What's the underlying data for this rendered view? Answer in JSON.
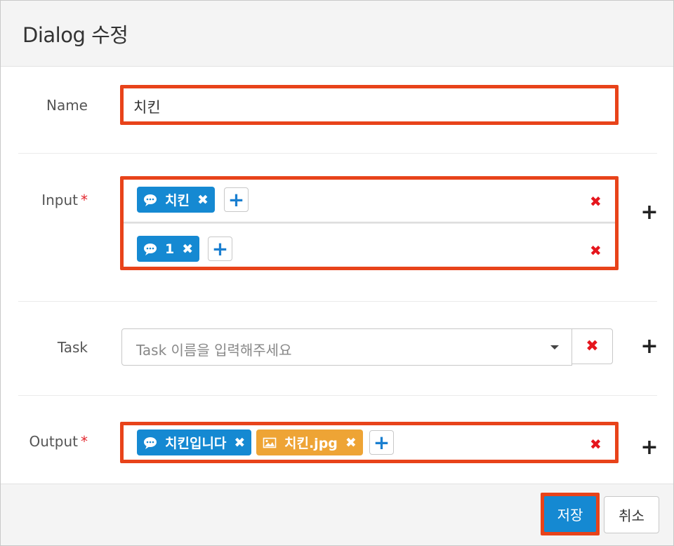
{
  "dialog": {
    "title": "Dialog 수정"
  },
  "fields": {
    "name": {
      "label": "Name",
      "value": "치킨"
    },
    "input": {
      "label": "Input",
      "required_mark": "*",
      "rows": [
        {
          "tags": [
            {
              "text": "치킨",
              "icon": "speech-bubble-icon",
              "remove": "✖"
            }
          ],
          "add": "+",
          "delete": "✖"
        },
        {
          "tags": [
            {
              "text": "1",
              "icon": "speech-bubble-icon",
              "remove": "✖"
            }
          ],
          "add": "+",
          "delete": "✖"
        }
      ],
      "add_row": "+"
    },
    "task": {
      "label": "Task",
      "placeholder": "Task 이름을 입력해주세요",
      "clear": "✖",
      "add_row": "+"
    },
    "output": {
      "label": "Output",
      "required_mark": "*",
      "rows": [
        {
          "tags": [
            {
              "text": "치킨입니다",
              "icon": "speech-bubble-icon",
              "remove": "✖",
              "color": "#1589d2"
            },
            {
              "text": "치킨.jpg",
              "icon": "image-icon",
              "remove": "✖",
              "color": "#eea435"
            }
          ],
          "add": "+",
          "delete": "✖"
        }
      ],
      "add_row": "+"
    }
  },
  "footer": {
    "save_label": "저장",
    "cancel_label": "취소"
  },
  "colors": {
    "primary": "#1589d2",
    "tag_image": "#eea435",
    "danger": "#e5161d",
    "highlight": "#e8431a"
  }
}
